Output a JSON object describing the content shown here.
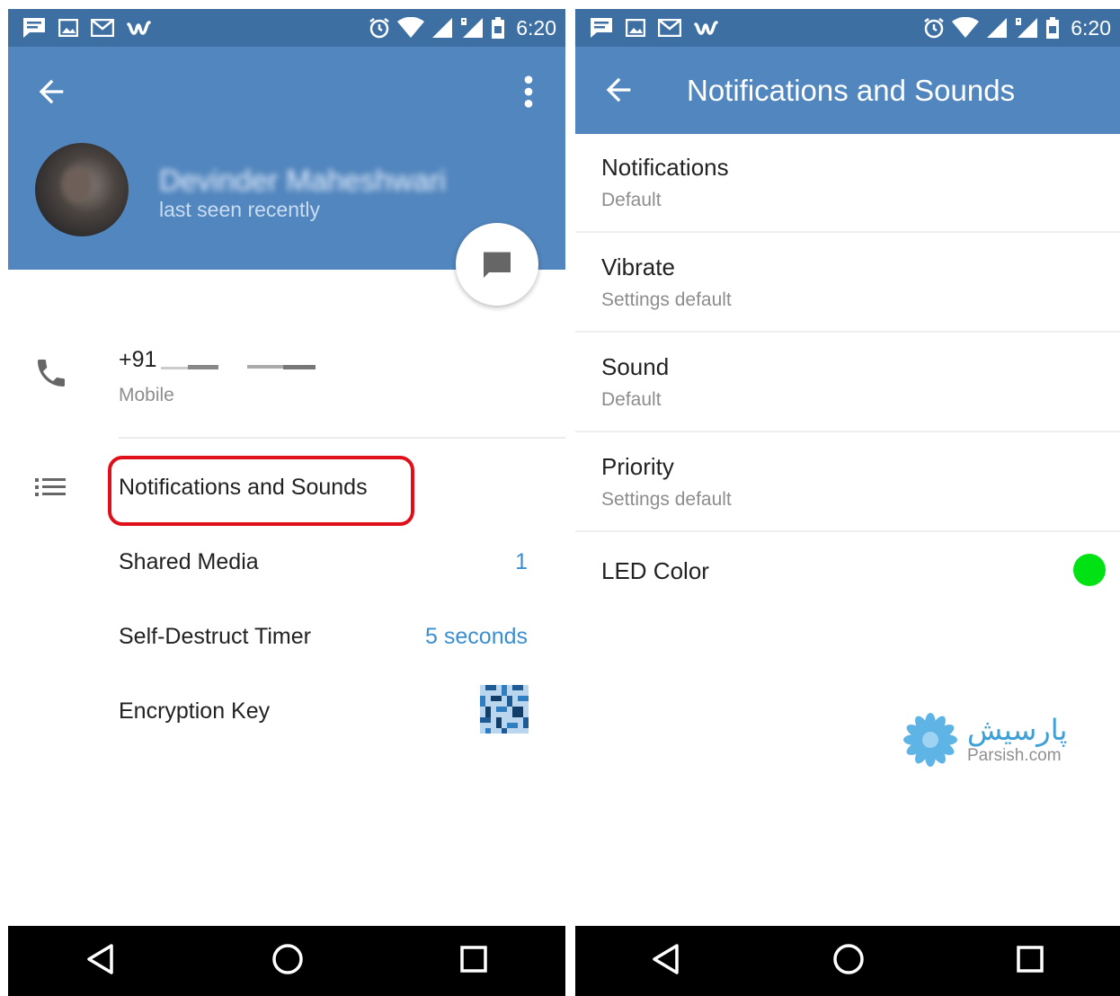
{
  "left_screen": {
    "status_bar": {
      "time": "6:20"
    },
    "profile": {
      "name": "Devinder Maheshwari",
      "status": "last seen recently"
    },
    "phone": {
      "number": "+91",
      "type": "Mobile"
    },
    "menu": {
      "notifications_label": "Notifications and Sounds",
      "shared_media_label": "Shared Media",
      "shared_media_count": "1",
      "self_destruct_label": "Self-Destruct Timer",
      "self_destruct_value": "5 seconds",
      "encryption_key_label": "Encryption Key"
    }
  },
  "right_screen": {
    "status_bar": {
      "time": "6:20"
    },
    "title": "Notifications and Sounds",
    "settings": [
      {
        "title": "Notifications",
        "subtitle": "Default"
      },
      {
        "title": "Vibrate",
        "subtitle": "Settings default"
      },
      {
        "title": "Sound",
        "subtitle": "Default"
      },
      {
        "title": "Priority",
        "subtitle": "Settings default"
      }
    ],
    "led": {
      "title": "LED Color",
      "color": "#00e213"
    },
    "watermark": {
      "fa": "پارسیش",
      "en": "Parsish.com"
    }
  },
  "colors": {
    "app_bar": "#5286be",
    "status_bar": "#3d6fa3",
    "accent_value": "#3a8fd1",
    "highlight_border": "#e0101a"
  },
  "icons": {
    "status_left": [
      "chat-notification-icon",
      "image-icon",
      "gmail-icon",
      "wish-icon"
    ],
    "status_right": [
      "alarm-icon",
      "wifi-icon",
      "signal-icon",
      "roaming-signal-icon",
      "battery-icon"
    ],
    "nav": [
      "back-triangle-icon",
      "home-circle-icon",
      "recents-square-icon"
    ]
  }
}
